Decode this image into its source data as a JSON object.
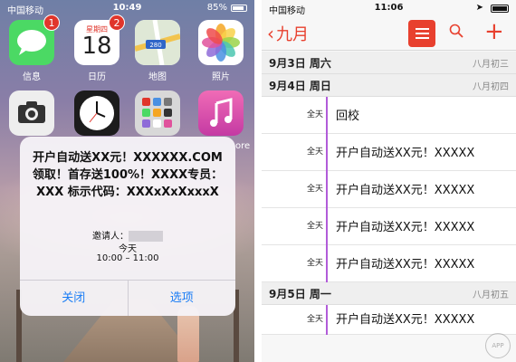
{
  "left": {
    "status": {
      "carrier": "中国移动",
      "time": "10:49",
      "battery": "85%"
    },
    "apps": [
      {
        "label": "信息",
        "badge": "1",
        "color": "#4bd964"
      },
      {
        "label": "日历",
        "badge": "2",
        "color": "#ffffff",
        "weekday": "星期四",
        "date": "18"
      },
      {
        "label": "地图",
        "badge": "",
        "color": "#e8eef3",
        "sign": "280"
      },
      {
        "label": "照片",
        "badge": "",
        "color": "#ffffff"
      },
      {
        "label": "",
        "badge": "",
        "color": "#eeeeee"
      },
      {
        "label": "",
        "badge": "",
        "color": "#1c1c1c"
      },
      {
        "label": "",
        "badge": "",
        "color": "#d8d8d8"
      },
      {
        "label": "",
        "badge": "",
        "color": "#e34c9f"
      }
    ],
    "partial_label": "ore",
    "alert": {
      "title": "开户自动送XX元！XXXXXX.COM领取！首存送100%！XXXX专员：XXX 标示代码：XXXxXxXxxxX",
      "inviter_label": "邀请人：",
      "day": "今天",
      "time_range": "10:00 – 11:00",
      "close": "关闭",
      "options": "选项"
    }
  },
  "right": {
    "status": {
      "carrier": "中国移动",
      "time": "11:06"
    },
    "nav": {
      "back_label": "九月"
    },
    "days": [
      {
        "date": "9月3日 周六",
        "lunar": "八月初三",
        "events": []
      },
      {
        "date": "9月4日 周日",
        "lunar": "八月初四",
        "events": [
          {
            "tag": "全天",
            "title": "回校"
          },
          {
            "tag": "全天",
            "title": "开户自动送XX元！XXXXX"
          },
          {
            "tag": "全天",
            "title": "开户自动送XX元！XXXXX"
          },
          {
            "tag": "全天",
            "title": "开户自动送XX元！XXXXX"
          },
          {
            "tag": "全天",
            "title": "开户自动送XX元！XXXXX"
          }
        ]
      },
      {
        "date": "9月5日 周一",
        "lunar": "八月初五",
        "events": [
          {
            "tag": "全天",
            "title": "开户自动送XX元！XXXXX"
          }
        ]
      }
    ],
    "watermark": "APP"
  }
}
